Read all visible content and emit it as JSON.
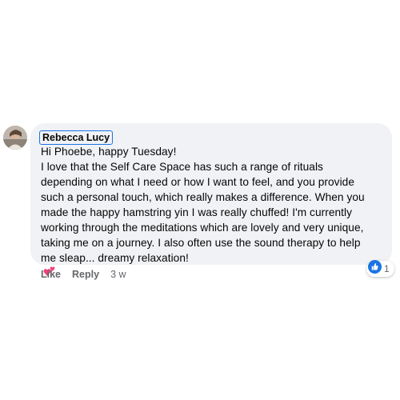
{
  "comment": {
    "author": "Rebecca Lucy",
    "lines": [
      "Hi Phoebe, happy Tuesday!",
      "I love that the Self Care Space has such a range of rituals",
      "depending on what I need or how I want to feel, and you provide",
      "such a personal touch, which really makes a difference. When you",
      "made the happy hamstring yin I was really chuffed! I'm currently",
      "working through the meditations which are lovely and very unique,",
      "taking me on a journey. I also often use the sound therapy to help",
      "me sleap... dreamy relaxation!"
    ],
    "emoji": "two-hearts-icon",
    "reactions": {
      "icon": "thumbs-up-icon",
      "count": "1"
    },
    "actions": {
      "like": "Like",
      "reply": "Reply",
      "time": "3 w"
    }
  },
  "colors": {
    "bubble": "#f0f2f5",
    "text": "#050505",
    "muted": "#65676b",
    "accent": "#1b74e4"
  }
}
